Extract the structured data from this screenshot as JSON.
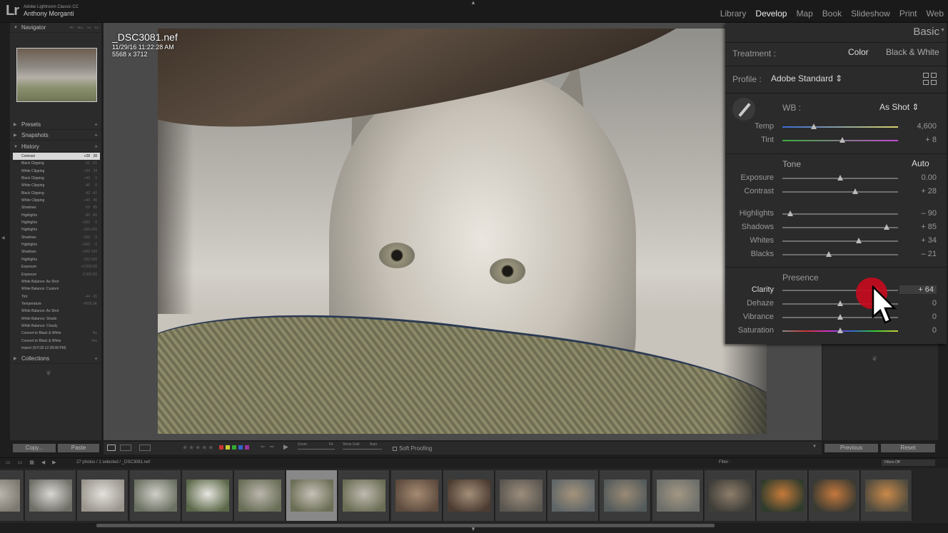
{
  "app": {
    "logo": "Lr",
    "app_name": "Adobe Lightroom Classic CC",
    "user": "Anthony Morganti"
  },
  "modules": [
    "Library",
    "Develop",
    "Map",
    "Book",
    "Slideshow",
    "Print",
    "Web"
  ],
  "active_module": "Develop",
  "left_panel": {
    "navigator": {
      "label": "Navigator",
      "zoom_options": [
        "FIT",
        "FILL",
        "1:1",
        "3:1"
      ]
    },
    "presets": {
      "label": "Presets"
    },
    "snapshots": {
      "label": "Snapshots"
    },
    "history": {
      "label": "History",
      "items": [
        {
          "label": "Contrast",
          "v1": "+28",
          "v2": "28"
        },
        {
          "label": "Black Clipping",
          "v1": "-21",
          "v2": "-21"
        },
        {
          "label": "White Clipping",
          "v1": "+34",
          "v2": "34"
        },
        {
          "label": "Black Clipping",
          "v1": "+42",
          "v2": "0"
        },
        {
          "label": "White Clipping",
          "v1": "-46",
          "v2": "0"
        },
        {
          "label": "Black Clipping",
          "v1": "-42",
          "v2": "-42"
        },
        {
          "label": "White Clipping",
          "v1": "+46",
          "v2": "46"
        },
        {
          "label": "Shadows",
          "v1": "-15",
          "v2": "85"
        },
        {
          "label": "Highlights",
          "v1": "-90",
          "v2": "-90"
        },
        {
          "label": "Highlights",
          "v1": "+100",
          "v2": "0"
        },
        {
          "label": "Highlights",
          "v1": "-100",
          "v2": "-100"
        },
        {
          "label": "Shadows",
          "v1": "-100",
          "v2": "0"
        },
        {
          "label": "Highlights",
          "v1": "+100",
          "v2": "0"
        },
        {
          "label": "Shadows",
          "v1": "+100",
          "v2": "100"
        },
        {
          "label": "Highlights",
          "v1": "-100",
          "v2": "-100"
        },
        {
          "label": "Exposure",
          "v1": "+2.50",
          "v2": "0.00"
        },
        {
          "label": "Exposure",
          "v1": "-2.50",
          "v2": "-2.50"
        },
        {
          "label": "White Balance: As Shot",
          "v1": "",
          "v2": ""
        },
        {
          "label": "White Balance: Custom",
          "v1": "",
          "v2": ""
        },
        {
          "label": "Tint",
          "v1": "-44",
          "v2": "-36"
        },
        {
          "label": "Temperature",
          "v1": "-425",
          "v2": "5.0K"
        },
        {
          "label": "White Balance: As Shot",
          "v1": "",
          "v2": ""
        },
        {
          "label": "White Balance: Shade",
          "v1": "",
          "v2": ""
        },
        {
          "label": "White Balance: Cloudy",
          "v1": "",
          "v2": ""
        },
        {
          "label": "Convert to Black & White",
          "v1": "",
          "v2": "No"
        },
        {
          "label": "Convert to Black & White",
          "v1": "",
          "v2": "Yes"
        },
        {
          "label": "Import (5/7/18 12:28:08 PM)",
          "v1": "",
          "v2": ""
        }
      ]
    },
    "collections": {
      "label": "Collections"
    },
    "copy_label": "Copy...",
    "paste_label": "Paste"
  },
  "photo": {
    "filename": "_DSC3081.nef",
    "datetime": "11/29/16 11:22:28 AM",
    "dimensions": "5568 x 3712"
  },
  "toolbar": {
    "stars": "★★★★★",
    "label_colors": [
      "#c33",
      "#cc3",
      "#3a3",
      "#36c",
      "#939"
    ],
    "zoom_label": "Zoom",
    "zoom_fit": "Fit",
    "grid_label": "Show Grid:",
    "grid_value": "Auto",
    "soft_proofing": "Soft Proofing"
  },
  "basic_panel": {
    "title": "Basic",
    "treatment_label": "Treatment :",
    "treatment_color": "Color",
    "treatment_bw": "Black & White",
    "profile_label": "Profile :",
    "profile_value": "Adobe Standard",
    "wb_label": "WB :",
    "wb_value": "As Shot",
    "tone_label": "Tone",
    "auto_label": "Auto",
    "presence_label": "Presence",
    "sliders": [
      {
        "label": "Temp",
        "value": "4,600",
        "pos": 0.27,
        "track": "temp"
      },
      {
        "label": "Tint",
        "value": "+ 8",
        "pos": 0.52,
        "track": "tint"
      },
      {
        "label": "Exposure",
        "value": "0.00",
        "pos": 0.5,
        "track": "gray"
      },
      {
        "label": "Contrast",
        "value": "+ 28",
        "pos": 0.63,
        "track": "gray"
      },
      {
        "label": "Highlights",
        "value": "– 90",
        "pos": 0.07,
        "track": "gray"
      },
      {
        "label": "Shadows",
        "value": "+ 85",
        "pos": 0.9,
        "track": "gray"
      },
      {
        "label": "Whites",
        "value": "+ 34",
        "pos": 0.66,
        "track": "gray"
      },
      {
        "label": "Blacks",
        "value": "– 21",
        "pos": 0.4,
        "track": "gray"
      },
      {
        "label": "Clarity",
        "value": "+ 64",
        "pos": 0.82,
        "track": "gray"
      },
      {
        "label": "Dehaze",
        "value": "0",
        "pos": 0.5,
        "track": "gray"
      },
      {
        "label": "Vibrance",
        "value": "0",
        "pos": 0.5,
        "track": "gray"
      },
      {
        "label": "Saturation",
        "value": "0",
        "pos": 0.5,
        "track": "sat"
      }
    ]
  },
  "right_panel": {
    "previous_label": "Previous",
    "reset_label": "Reset"
  },
  "filmstrip": {
    "info": "27 photos / 1 selected / _DSC3081.nef",
    "filter_label": "Filter :",
    "filter_value": "Filters Off",
    "thumbs": [
      {
        "colors": [
          "#7d786f",
          "#bdb8b0"
        ],
        "selected": false
      },
      {
        "colors": [
          "#6e6d66",
          "#d9d7d2"
        ],
        "selected": false
      },
      {
        "colors": [
          "#9a958d",
          "#e3e1dc"
        ],
        "selected": false
      },
      {
        "colors": [
          "#6a7162",
          "#d0cec8"
        ],
        "selected": false
      },
      {
        "colors": [
          "#5b6848",
          "#e8e6e1"
        ],
        "selected": false
      },
      {
        "colors": [
          "#686e56",
          "#bcb6ad"
        ],
        "selected": false
      },
      {
        "colors": [
          "#6b6e55",
          "#c6c0b6"
        ],
        "selected": true
      },
      {
        "colors": [
          "#6a6d54",
          "#c0bab0"
        ],
        "selected": false
      },
      {
        "colors": [
          "#5c4a3d",
          "#a58a72"
        ],
        "selected": false
      },
      {
        "colors": [
          "#4b3b31",
          "#a48e78"
        ],
        "selected": false
      },
      {
        "colors": [
          "#5a5650",
          "#9c8d7c"
        ],
        "selected": false
      },
      {
        "colors": [
          "#5f6668",
          "#a5937b"
        ],
        "selected": false
      },
      {
        "colors": [
          "#545b5b",
          "#9a8a75"
        ],
        "selected": false
      },
      {
        "colors": [
          "#6c6e6a",
          "#a39783"
        ],
        "selected": false
      },
      {
        "colors": [
          "#3e3d38",
          "#8e7d6a"
        ],
        "selected": false
      },
      {
        "colors": [
          "#2f3b2c",
          "#c67a3a"
        ],
        "selected": false
      },
      {
        "colors": [
          "#3a3a32",
          "#c5783c"
        ],
        "selected": false
      },
      {
        "colors": [
          "#4e4a3e",
          "#c9894a"
        ],
        "selected": false
      }
    ]
  }
}
